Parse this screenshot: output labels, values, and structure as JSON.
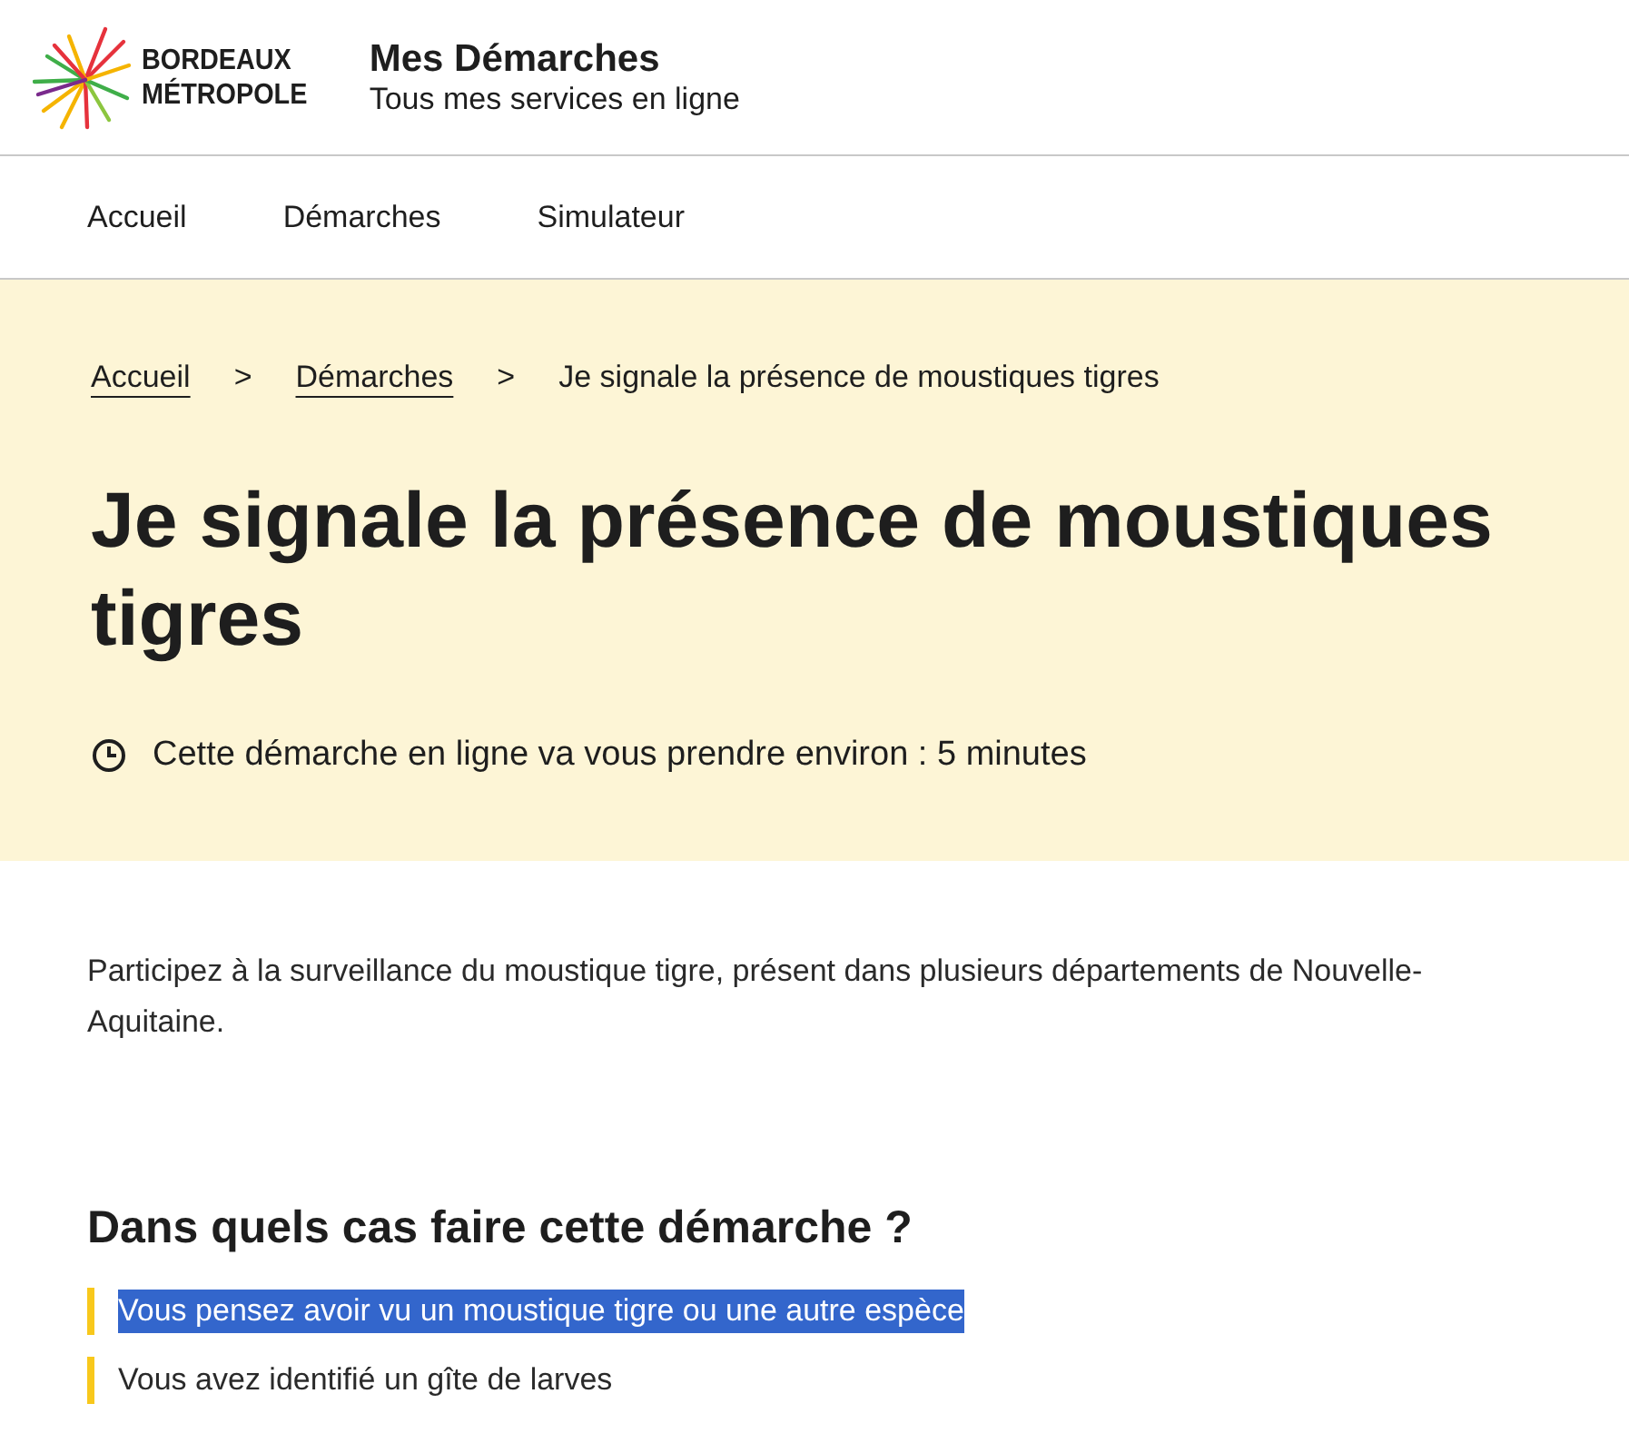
{
  "header": {
    "logo_lines": [
      "BORDEAUX",
      "MÉTROPOLE"
    ],
    "site_title": "Mes Démarches",
    "site_subtitle": "Tous mes services en ligne"
  },
  "nav": {
    "items": [
      {
        "label": "Accueil"
      },
      {
        "label": "Démarches"
      },
      {
        "label": "Simulateur"
      }
    ]
  },
  "breadcrumb": [
    {
      "label": "Accueil",
      "kind": "link"
    },
    {
      "label": ">",
      "kind": "separator"
    },
    {
      "label": "Démarches",
      "kind": "link"
    },
    {
      "label": ">",
      "kind": "separator"
    },
    {
      "label": "Je signale la présence de moustiques tigres",
      "kind": "current"
    }
  ],
  "page_title": "Je signale la présence de moustiques tigres",
  "duration": "Cette démarche en ligne va vous prendre environ : 5 minutes",
  "intro": "Participez à la surveillance du moustique tigre, présent dans plusieurs départements de Nouvelle-Aquitaine.",
  "cases": {
    "heading": "Dans quels cas faire cette démarche ?",
    "items": [
      {
        "text": "Vous pensez avoir vu un moustique tigre ou une autre espèce",
        "selected": true
      },
      {
        "text": "Vous avez identifié un gîte de larves",
        "selected": false
      }
    ]
  }
}
